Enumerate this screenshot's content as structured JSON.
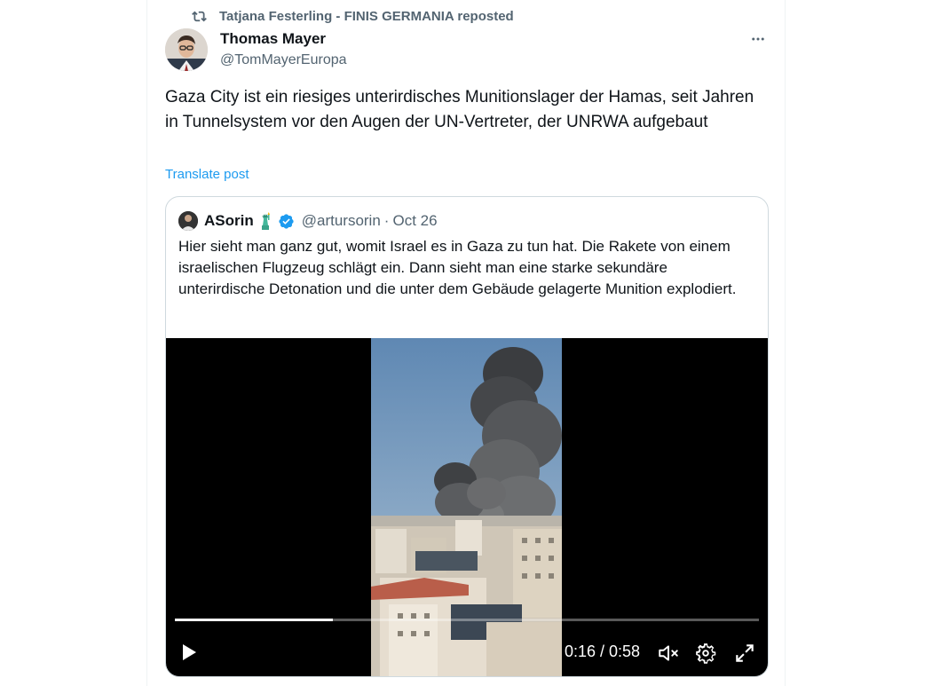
{
  "repost": {
    "icon": "repost-icon",
    "text": "Tatjana Festerling - FINIS GERMANIA reposted"
  },
  "author": {
    "name": "Thomas Mayer",
    "handle": "@TomMayerEuropa"
  },
  "post": {
    "text": "Gaza City ist ein riesiges unterirdisches Munitionslager der Hamas, seit Jahren in Tunnelsystem vor den Augen der UN-Vertreter, der UNRWA aufgebaut",
    "translate_label": "Translate post"
  },
  "quote": {
    "name": "ASorin",
    "emoji": "🗽",
    "handle": "@artursorin",
    "separator": "·",
    "date": "Oct 26",
    "text": "Hier sieht man ganz gut, womit Israel es in Gaza zu tun hat. Die Rakete von einem israelischen Flugzeug schlägt ein. Dann sieht man eine starke sekundäre unterirdische Detonation und die unter dem Gebäude gelagerte Munition explodiert."
  },
  "video": {
    "time": "0:16 / 0:58",
    "progress": 0.27,
    "controls": [
      "play-icon",
      "mute-icon",
      "settings-icon",
      "fullscreen-icon"
    ]
  },
  "colors": {
    "accent": "#1d9bf0",
    "secondary_text": "#536471",
    "border": "#cfd9de"
  }
}
